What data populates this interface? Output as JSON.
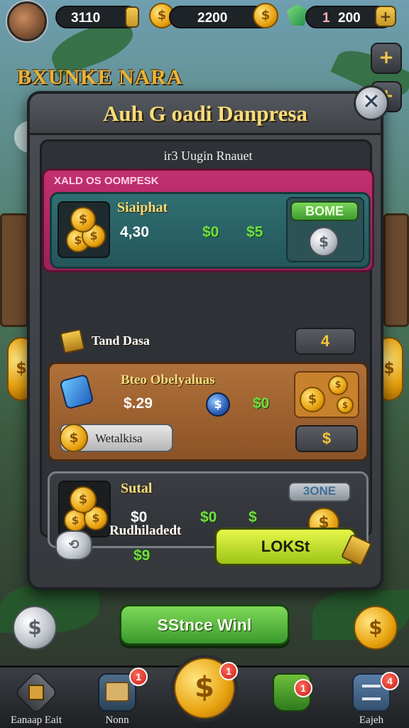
{
  "top_bar": {
    "resource_1": "3110",
    "resource_2": "2200",
    "resource_3_count": "1",
    "resource_3": "200",
    "plus": "+"
  },
  "background_logo": "BXUNKE NARA",
  "modal": {
    "title": "Auh G oadi Danpresa",
    "close": "✕",
    "subtitle": "ir3 Uugin Rnauet",
    "section_label": "XALD OS OOMPESK",
    "items": [
      {
        "name": "Siaiphat",
        "price": "4,30",
        "value_1": "$0",
        "value_2": "$5",
        "action": "BOME"
      },
      {
        "name": "Bteo Obelyaluas",
        "price": "$.29",
        "value_2": "$0",
        "sub_label": "Wetalkisa",
        "action": "$"
      },
      {
        "name": "Sutal",
        "price": "$0",
        "value_1": "$0",
        "value_2": "$",
        "action": "3ONE"
      }
    ],
    "row_label": "Tand Dasa",
    "row_value": "4",
    "footer_label": "Rudhiladedt",
    "footer_value": "$9",
    "footer_button": "LOKSt"
  },
  "cta_button": "SStnce Winl",
  "bottom_nav": [
    {
      "label": "Eanaap Eait"
    },
    {
      "label": "Nonn",
      "badge": "1"
    },
    {
      "label": "",
      "badge": "1"
    },
    {
      "label": "",
      "badge": "1"
    },
    {
      "label": "Eajeh",
      "badge": "4"
    }
  ],
  "colors": {
    "gold": "#f6dc7a",
    "green_value": "#6fe040",
    "pink_section": "#c2306f",
    "teal_card": "#2f6f73",
    "orange_card": "#b0713a"
  },
  "icons": [
    "avatar",
    "gold-coin-icon",
    "silver-coin-icon",
    "gem-icon",
    "plus-icon",
    "close-icon",
    "coin-stack-icon",
    "shield-gem-icon",
    "tag-icon",
    "home-icon",
    "map-icon",
    "dollar-coin-icon",
    "potion-icon",
    "calendar-icon"
  ]
}
